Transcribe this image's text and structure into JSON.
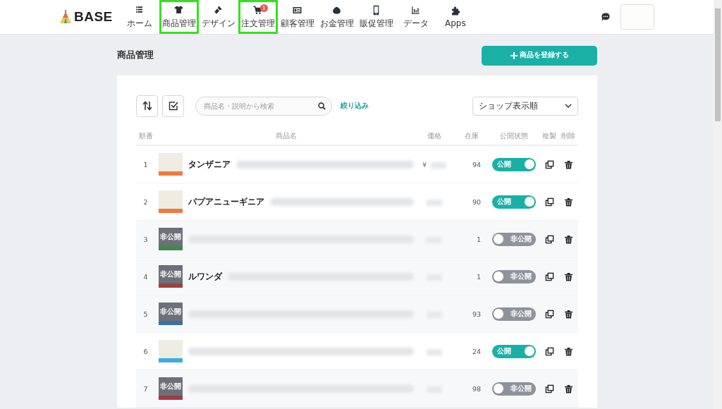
{
  "header": {
    "logo": "BASE",
    "nav": [
      {
        "label": "ホーム",
        "highlighted": false
      },
      {
        "label": "商品管理",
        "highlighted": true
      },
      {
        "label": "デザイン",
        "highlighted": false
      },
      {
        "label": "注文管理",
        "highlighted": true,
        "badge": "1"
      },
      {
        "label": "顧客管理",
        "highlighted": false
      },
      {
        "label": "お金管理",
        "highlighted": false
      },
      {
        "label": "販促管理",
        "highlighted": false
      },
      {
        "label": "データ",
        "highlighted": false
      },
      {
        "label": "Apps",
        "highlighted": false
      }
    ]
  },
  "page": {
    "title": "商品管理",
    "add_button": "商品を登録する"
  },
  "toolbar": {
    "search": {
      "placeholder": "商品名・説明から検索"
    },
    "filter_link": "絞り込み",
    "sort_select": "ショップ表示順"
  },
  "table": {
    "columns": [
      "順番",
      "商品名",
      "価格",
      "在庫",
      "公開状態",
      "複製",
      "削除"
    ],
    "rows": [
      {
        "number": "1",
        "name": "タンザニア",
        "price": "¥",
        "stock": "94",
        "published": true,
        "status": "公開",
        "color": "#f07a3e"
      },
      {
        "number": "2",
        "name": "パプアニューギニア",
        "stock": "90",
        "published": true,
        "status": "公開",
        "color": "#f07a3e"
      },
      {
        "number": "3",
        "stock": "1",
        "published": false,
        "status": "非公開",
        "thumb_label": "非公開",
        "color": "#3f8a4a"
      },
      {
        "number": "4",
        "name": "ルワンダ",
        "stock": "1",
        "published": false,
        "status": "非公開",
        "thumb_label": "非公開",
        "color": "#a0413c"
      },
      {
        "number": "5",
        "stock": "93",
        "published": false,
        "status": "非公開",
        "thumb_label": "非公開",
        "color": "#3b72a8"
      },
      {
        "number": "6",
        "stock": "24",
        "published": true,
        "status": "公開",
        "color": "#3aaee0"
      },
      {
        "number": "7",
        "stock": "98",
        "published": false,
        "status": "非公開",
        "thumb_label": "非公開",
        "color": "#a03a48"
      }
    ]
  }
}
